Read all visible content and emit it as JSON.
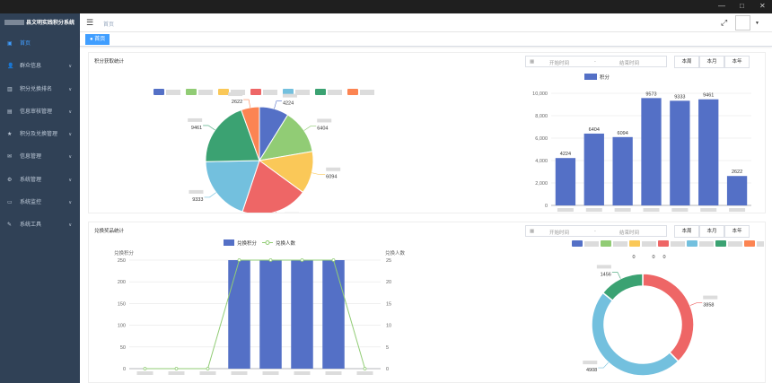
{
  "window_controls": {
    "minimize": "—",
    "maximize": "□",
    "close": "✕"
  },
  "app": {
    "title": "县文明实践积分系统"
  },
  "sidebar": {
    "items": [
      {
        "label": "首页",
        "icon": "dashboard-icon",
        "active": true,
        "has_children": false
      },
      {
        "label": "群众信息",
        "icon": "user-icon",
        "active": false,
        "has_children": true
      },
      {
        "label": "积分兑换排名",
        "icon": "chart-icon",
        "active": false,
        "has_children": true
      },
      {
        "label": "信息审核管理",
        "icon": "document-icon",
        "active": false,
        "has_children": true
      },
      {
        "label": "积分及兑换管理",
        "icon": "star-icon",
        "active": false,
        "has_children": true
      },
      {
        "label": "信息管理",
        "icon": "message-icon",
        "active": false,
        "has_children": true
      },
      {
        "label": "系统管理",
        "icon": "gear-icon",
        "active": false,
        "has_children": true
      },
      {
        "label": "系统监控",
        "icon": "monitor-icon",
        "active": false,
        "has_children": true
      },
      {
        "label": "系统工具",
        "icon": "tool-icon",
        "active": false,
        "has_children": true
      }
    ]
  },
  "navbar": {
    "breadcrumb": "首页"
  },
  "tags": [
    {
      "label": "● 首页"
    }
  ],
  "points_panel": {
    "title": "积分获取统计",
    "start_placeholder": "开始时间",
    "separator": "-",
    "end_placeholder": "结束时间",
    "buttons": [
      "本周",
      "本月",
      "本年"
    ],
    "bar_legend": "积分"
  },
  "exchange_panel": {
    "title": "兑换奖品统计",
    "start_placeholder": "开始时间",
    "separator": "-",
    "end_placeholder": "结束时间",
    "buttons": [
      "本周",
      "本月",
      "本年"
    ],
    "legend_bar": "兑换积分",
    "legend_line": "兑换人数",
    "left_axis_label": "兑换积分",
    "right_axis_label": "兑换人数"
  },
  "colors": {
    "sidebar_bg": "#304156",
    "active_menu": "#409eff",
    "tag_bg": "#409eff",
    "series": [
      "#5470c6",
      "#91cc75",
      "#fac858",
      "#ee6666",
      "#73c0de",
      "#3ba272",
      "#fc8452"
    ]
  },
  "chart_data": [
    {
      "type": "pie",
      "values": [
        4224,
        6404,
        6094,
        9573,
        9333,
        9461,
        2622
      ],
      "colors": [
        "#5470c6",
        "#91cc75",
        "#fac858",
        "#ee6666",
        "#73c0de",
        "#3ba272",
        "#fc8452"
      ]
    },
    {
      "type": "bar",
      "values": [
        4224,
        6404,
        6094,
        9573,
        9333,
        9461,
        2622
      ],
      "legend": [
        "积分"
      ],
      "ylim": [
        0,
        10000
      ],
      "yticks": [
        "0",
        "2,000",
        "4,000",
        "6,000",
        "8,000",
        "10,000"
      ],
      "grid": true
    },
    {
      "type": "bar+line",
      "series": [
        {
          "name": "兑换积分",
          "type": "bar",
          "values": [
            0,
            0,
            0,
            250,
            250,
            250,
            250,
            0
          ]
        },
        {
          "name": "兑换人数",
          "type": "line",
          "values": [
            0,
            0,
            0,
            25,
            25,
            25,
            25,
            0
          ]
        }
      ],
      "ylim_left": [
        0,
        250
      ],
      "yticks_left": [
        "0",
        "50",
        "100",
        "150",
        "200",
        "250"
      ],
      "ylim_right": [
        0,
        25
      ],
      "yticks_right": [
        "0",
        "5",
        "10",
        "15",
        "20",
        "25"
      ]
    },
    {
      "type": "pie",
      "style": "donut",
      "values": [
        0,
        0,
        0,
        3858,
        4908,
        1456,
        0
      ],
      "colors": [
        "#5470c6",
        "#91cc75",
        "#fac858",
        "#ee6666",
        "#73c0de",
        "#3ba272",
        "#fc8452"
      ]
    }
  ]
}
